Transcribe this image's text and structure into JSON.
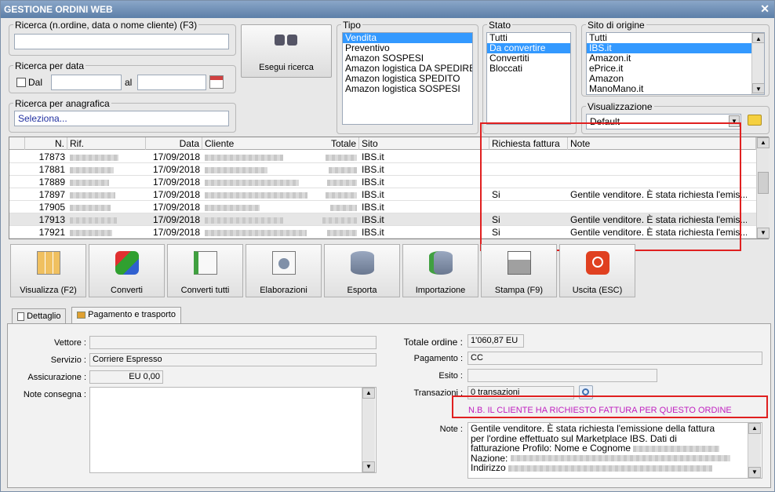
{
  "window": {
    "title": "GESTIONE ORDINI WEB",
    "close_glyph": "✕"
  },
  "search": {
    "label": "Ricerca (n.ordine, data o nome cliente) (F3)",
    "value": "",
    "date_label": "Ricerca per data",
    "dal_label": "Dal",
    "al_label": "al",
    "registry_label": "Ricerca per anagrafica",
    "registry_value": "Seleziona...",
    "button": "Esegui ricerca"
  },
  "tipo": {
    "label": "Tipo",
    "items": [
      "Vendita",
      "Preventivo",
      "Amazon SOSPESI",
      "Amazon logistica DA SPEDIRE",
      "Amazon logistica SPEDITO",
      "Amazon logistica SOSPESI"
    ],
    "selected": 0
  },
  "stato": {
    "label": "Stato",
    "items": [
      "Tutti",
      "Da convertire",
      "Convertiti",
      "Bloccati"
    ],
    "selected": 1
  },
  "sito": {
    "label": "Sito di origine",
    "items": [
      "Tutti",
      "IBS.it",
      "Amazon.it",
      "ePrice.it",
      "Amazon",
      "ManoMano.it"
    ],
    "selected": 1
  },
  "visualizzazione": {
    "label": "Visualizzazione",
    "value": "Default"
  },
  "grid": {
    "headers": {
      "n": "N.",
      "rif": "Rif.",
      "data": "Data",
      "cliente": "Cliente",
      "totale": "Totale",
      "sito": "Sito",
      "richiesta": "Richiesta fattura",
      "note": "Note"
    },
    "rows": [
      {
        "n": "17873",
        "data": "17/09/2018",
        "sito": "IBS.it",
        "richiesta": "",
        "note": ""
      },
      {
        "n": "17881",
        "data": "17/09/2018",
        "sito": "IBS.it",
        "richiesta": "",
        "note": ""
      },
      {
        "n": "17889",
        "data": "17/09/2018",
        "sito": "IBS.it",
        "richiesta": "",
        "note": ""
      },
      {
        "n": "17897",
        "data": "17/09/2018",
        "sito": "IBS.it",
        "richiesta": "Si",
        "note": "Gentile venditore.  È stata richiesta l'emis..."
      },
      {
        "n": "17905",
        "data": "17/09/2018",
        "sito": "IBS.it",
        "richiesta": "",
        "note": ""
      },
      {
        "n": "17913",
        "data": "17/09/2018",
        "sito": "IBS.it",
        "richiesta": "Si",
        "note": "Gentile venditore.  È stata richiesta l'emis..."
      },
      {
        "n": "17921",
        "data": "17/09/2018",
        "sito": "IBS.it",
        "richiesta": "Si",
        "note": "Gentile venditore.  È stata richiesta l'emis..."
      }
    ]
  },
  "toolbar": [
    "Visualizza (F2)",
    "Converti",
    "Converti tutti",
    "Elaborazioni",
    "Esporta",
    "Importazione",
    "Stampa (F9)",
    "Uscita (ESC)"
  ],
  "tabs": {
    "dettaglio": "Dettaglio",
    "pagamento": "Pagamento e trasporto"
  },
  "detail": {
    "vettore_label": "Vettore :",
    "vettore": "",
    "servizio_label": "Servizio :",
    "servizio": "Corriere Espresso",
    "assicurazione_label": "Assicurazione :",
    "assicurazione": "EU 0,00",
    "note_consegna_label": "Note consegna :",
    "totale_label": "Totale ordine :",
    "totale": "1'060,87 EU",
    "pagamento_label": "Pagamento :",
    "pagamento": "CC",
    "esito_label": "Esito :",
    "esito": "",
    "transazioni_label": "Transazioni :",
    "transazioni": "0 transazioni",
    "nb": "N.B. IL CLIENTE HA RICHIESTO FATTURA PER QUESTO ORDINE",
    "note_label": "Note :",
    "note_lines": [
      "Gentile venditore.  È stata richiesta l'emissione della fattura",
      "per l'ordine effettuato sul Marketplace IBS.    Dati di",
      "fatturazione    Profilo:  Nome e Cognome",
      "Nazione:",
      "Indirizzo"
    ]
  },
  "colors": {
    "selection": "#3399ff",
    "highlight": "#e02020",
    "nb_text": "#c020c0"
  }
}
